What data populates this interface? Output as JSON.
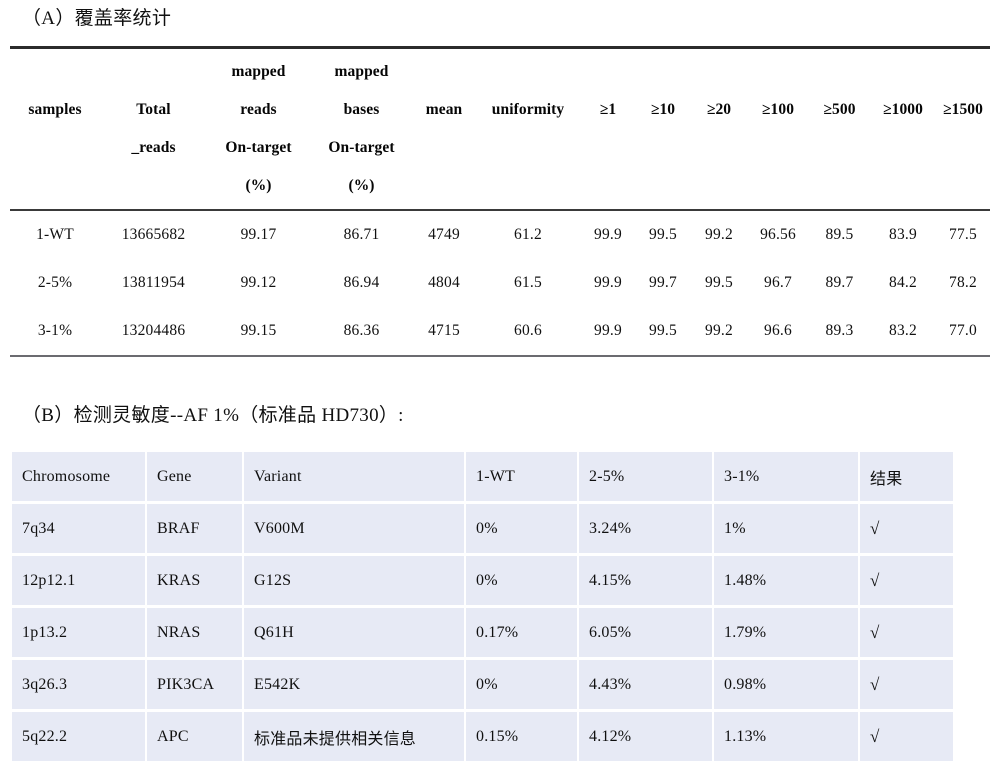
{
  "section_a": {
    "title": "（A）覆盖率统计",
    "table": {
      "headers": [
        {
          "lines": [
            "",
            "samples",
            "",
            ""
          ]
        },
        {
          "lines": [
            "",
            "Total",
            "_reads",
            ""
          ]
        },
        {
          "lines": [
            "mapped",
            "reads",
            "On-target",
            "(%)"
          ]
        },
        {
          "lines": [
            "mapped",
            "bases",
            "On-target",
            "(%)"
          ]
        },
        {
          "lines": [
            "",
            "mean",
            "",
            ""
          ]
        },
        {
          "lines": [
            "",
            "uniformity",
            "",
            ""
          ]
        },
        {
          "lines": [
            "",
            "≥1",
            "",
            ""
          ]
        },
        {
          "lines": [
            "",
            "≥10",
            "",
            ""
          ]
        },
        {
          "lines": [
            "",
            "≥20",
            "",
            ""
          ]
        },
        {
          "lines": [
            "",
            "≥100",
            "",
            ""
          ]
        },
        {
          "lines": [
            "",
            "≥500",
            "",
            ""
          ]
        },
        {
          "lines": [
            "",
            "≥1000",
            "",
            ""
          ]
        },
        {
          "lines": [
            "",
            "≥1500",
            "",
            ""
          ]
        }
      ],
      "rows": [
        [
          "1-WT",
          "13665682",
          "99.17",
          "86.71",
          "4749",
          "61.2",
          "99.9",
          "99.5",
          "99.2",
          "96.56",
          "89.5",
          "83.9",
          "77.5"
        ],
        [
          "2-5%",
          "13811954",
          "99.12",
          "86.94",
          "4804",
          "61.5",
          "99.9",
          "99.7",
          "99.5",
          "96.7",
          "89.7",
          "84.2",
          "78.2"
        ],
        [
          "3-1%",
          "13204486",
          "99.15",
          "86.36",
          "4715",
          "60.6",
          "99.9",
          "99.5",
          "99.2",
          "96.6",
          "89.3",
          "83.2",
          "77.0"
        ]
      ]
    }
  },
  "section_b": {
    "title": "（B）检测灵敏度--AF 1%（标准品 HD730）:",
    "table": {
      "headers": [
        "Chromosome",
        "Gene",
        "Variant",
        "1-WT",
        "2-5%",
        "3-1%",
        "结果"
      ],
      "rows": [
        [
          "7q34",
          "BRAF",
          "V600M",
          "0%",
          "3.24%",
          "1%",
          "√"
        ],
        [
          "12p12.1",
          "KRAS",
          "G12S",
          "0%",
          "4.15%",
          "1.48%",
          "√"
        ],
        [
          "1p13.2",
          "NRAS",
          "Q61H",
          "0.17%",
          "6.05%",
          "1.79%",
          "√"
        ],
        [
          "3q26.3",
          "PIK3CA",
          "E542K",
          "0%",
          "4.43%",
          "0.98%",
          "√"
        ],
        [
          "5q22.2",
          "APC",
          "标准品未提供相关信息",
          "0.15%",
          "4.12%",
          "1.13%",
          "√"
        ]
      ]
    }
  },
  "colors": {
    "table_b_fill": "#e7eaf5",
    "gridline": "#ffffff",
    "rule": "#2b2b2b",
    "text": "#101010"
  }
}
